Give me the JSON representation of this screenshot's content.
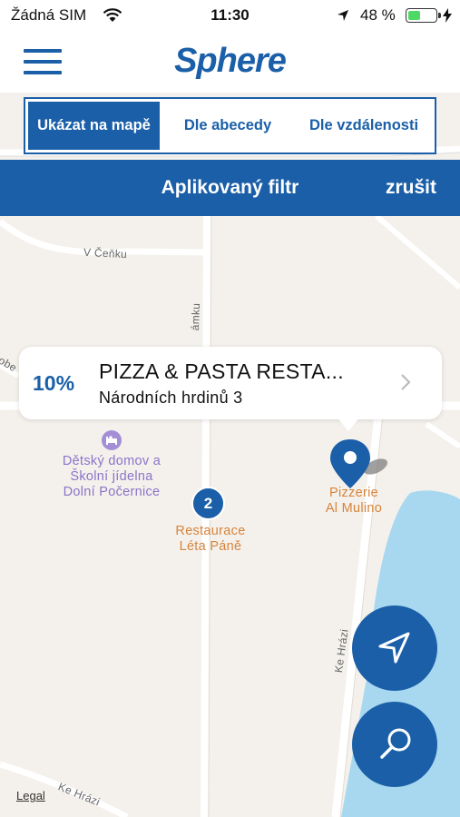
{
  "status_bar": {
    "carrier": "Žádná SIM",
    "time": "11:30",
    "battery_percent": "48 %",
    "battery_level": 0.48
  },
  "header": {
    "logo": "Sphere"
  },
  "segments": [
    {
      "label": "Ukázat na mapě"
    },
    {
      "label": "Dle abecedy"
    },
    {
      "label": "Dle vzdálenosti"
    }
  ],
  "filter_bar": {
    "title": "Aplikovaný filtr",
    "cancel": "zrušit"
  },
  "callout": {
    "discount": "10%",
    "name": "PIZZA & PASTA RESTA...",
    "address": "Národních hrdinů  3"
  },
  "map": {
    "streets": {
      "v_cenku": "V Čeňku",
      "amku": "ámku",
      "obe": "obe",
      "ke_hrazi_1": "Ke Hrázi",
      "ke_hrazi_2": "Ke Hrázi"
    },
    "pois": {
      "childrens_home": "Dětský domov a\nŠkolní jídelna\nDolní Počernice",
      "restaurace": "Restaurace\nLéta Páně",
      "pizzerie": "Pizzerie\nAl Mulino"
    },
    "cluster_count": "2",
    "legal": "Legal"
  },
  "colors": {
    "brand": "#1a5fa8",
    "map_bg": "#f4f1ec",
    "water": "#a8d8f0",
    "poi_purple": "#8a74c9",
    "poi_orange": "#d7833b"
  }
}
